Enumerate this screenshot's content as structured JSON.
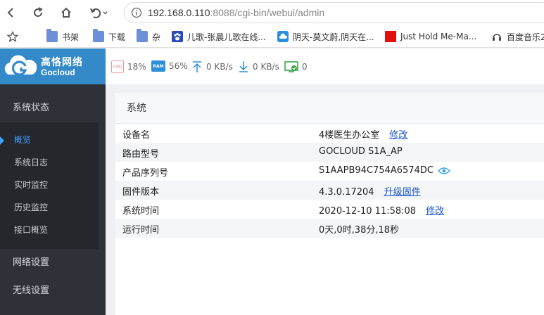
{
  "browser": {
    "url_host": "192.168.0.110",
    "url_rest": ":8088/cgi-bin/webui/admin",
    "bookmarks": [
      {
        "label": "书架",
        "icon": "folder-icon"
      },
      {
        "label": "下载",
        "icon": "folder-icon"
      },
      {
        "label": "杂",
        "icon": "folder-icon"
      },
      {
        "label": "儿歌-张晨儿歌在线...",
        "icon": "paw-icon"
      },
      {
        "label": "阴天-莫文蔚,阴天在...",
        "icon": "cloud-icon"
      },
      {
        "label": "Just Hold Me-Ma...",
        "icon": "red-square-icon"
      },
      {
        "label": "百度音乐2",
        "icon": "headphones-icon"
      }
    ]
  },
  "header": {
    "logo_cn": "高恪网络",
    "logo_en": "Gocloud",
    "cpu_label": "CPU",
    "cpu": "18%",
    "ram_label": "RAM",
    "ram": "56%",
    "upload": "0 KB/s",
    "download": "0 KB/s",
    "connections": "0",
    "colors": {
      "brand": "#3489c9",
      "sidebar": "#2e3238",
      "active": "#3fa0ff",
      "link": "#1a56c9"
    }
  },
  "sidebar": {
    "group_status": "系统状态",
    "items": [
      "概览",
      "系统日志",
      "实时监控",
      "历史监控",
      "接口概览"
    ],
    "group_network": "网络设置",
    "group_wireless": "无线设置"
  },
  "main": {
    "card_title": "系统",
    "rows": [
      {
        "key": "设备名",
        "value": "4楼医生办公室",
        "link": "修改"
      },
      {
        "key": "路由型号",
        "value": "GOCLOUD S1A_AP"
      },
      {
        "key": "产品序列号",
        "value": "S1AAPB94C754A6574DC"
      },
      {
        "key": "固件版本",
        "value": "4.3.0.17204",
        "link": "升级固件"
      },
      {
        "key": "系统时间",
        "value": "2020-12-10 11:58:08",
        "link": "修改"
      },
      {
        "key": "运行时间",
        "value": "0天,0时,38分,18秒"
      }
    ]
  }
}
